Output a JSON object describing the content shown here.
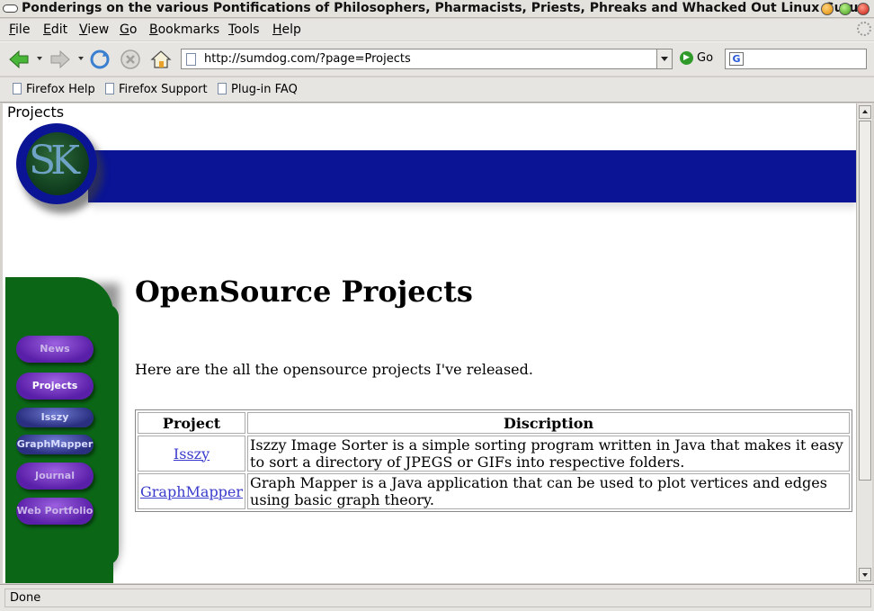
{
  "window": {
    "title": "Ponderings on the various Pontifications of Philosophers, Pharmacists, Priests, Phreaks and Whacked Out Linux Gurus"
  },
  "menubar": {
    "items": [
      {
        "label": "File",
        "accel": "F",
        "rest": "ile"
      },
      {
        "label": "Edit",
        "accel": "E",
        "rest": "dit"
      },
      {
        "label": "View",
        "accel": "V",
        "rest": "iew"
      },
      {
        "label": "Go",
        "accel": "G",
        "rest": "o"
      },
      {
        "label": "Bookmarks",
        "accel": "B",
        "rest": "ookmarks"
      },
      {
        "label": "Tools",
        "accel": "T",
        "rest": "ools"
      },
      {
        "label": "Help",
        "accel": "H",
        "rest": "elp"
      }
    ]
  },
  "navbar": {
    "url": "http://sumdog.com/?page=Projects",
    "go_label": "Go",
    "search_engine_letter": "G"
  },
  "bookmarks": [
    {
      "label": "Firefox Help"
    },
    {
      "label": "Firefox Support"
    },
    {
      "label": "Plug-in FAQ"
    }
  ],
  "page": {
    "tab_label": "Projects",
    "logo_text": "SK",
    "nav": [
      {
        "label": "News"
      },
      {
        "label": "Projects"
      },
      {
        "label": "Isszy"
      },
      {
        "label": "GraphMapper"
      },
      {
        "label": "Journal"
      },
      {
        "label": "Web Portfolio"
      }
    ],
    "heading": "OpenSource Projects",
    "intro": "Here are the all the opensource projects I've released.",
    "table": {
      "headers": [
        "Project",
        "Discription"
      ],
      "rows": [
        {
          "name": "Isszy",
          "description": "Iszzy Image Sorter is a simple sorting program written in Java that makes it easy to sort a directory of JPEGS or GIFs into respective folders."
        },
        {
          "name": "GraphMapper",
          "description": "Graph Mapper is a Java application that can be used to plot vertices and edges using basic graph theory."
        }
      ]
    }
  },
  "status": {
    "text": "Done"
  },
  "colors": {
    "banner": "#0a1494",
    "sidebar": "#0b6616",
    "nav_button": "#6a2bbf",
    "link": "#3a3acc"
  }
}
